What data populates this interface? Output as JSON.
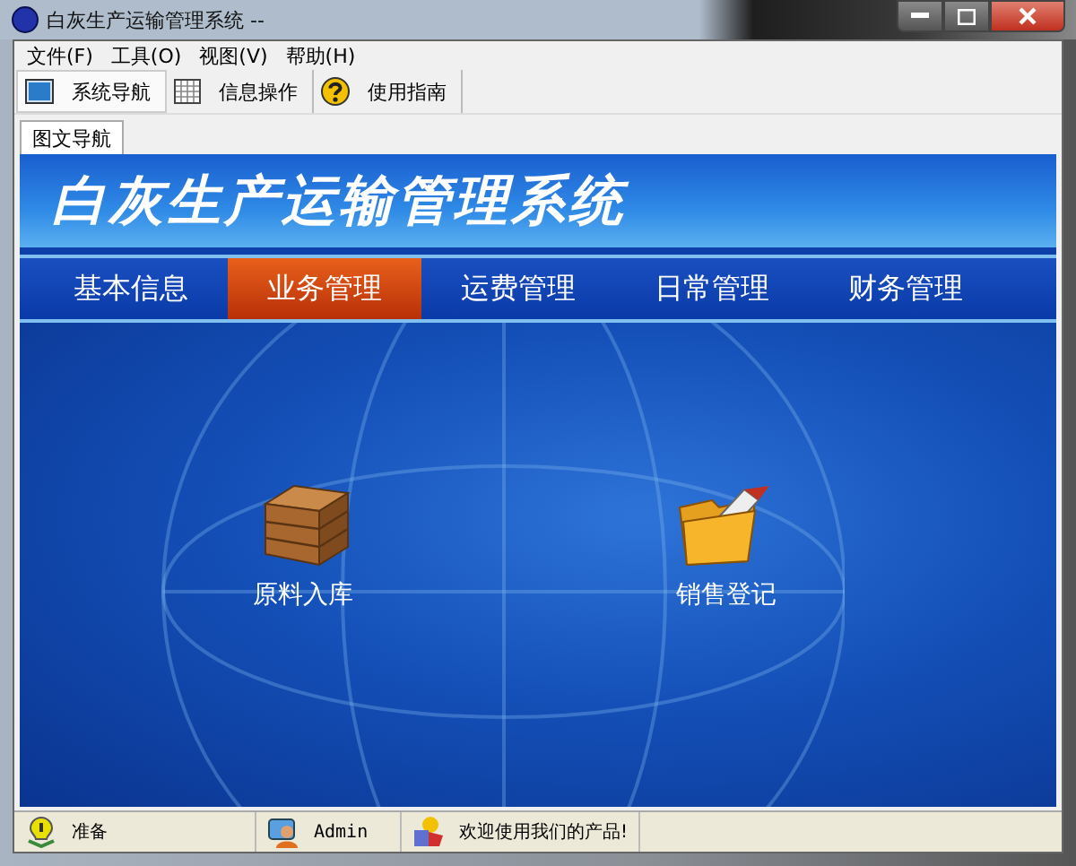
{
  "window": {
    "title": "白灰生产运输管理系统 --"
  },
  "menu": [
    {
      "label": "文件(F)"
    },
    {
      "label": "工具(O)"
    },
    {
      "label": "视图(V)"
    },
    {
      "label": "帮助(H)"
    }
  ],
  "toolbar": [
    {
      "label": "系统导航",
      "kind": "nav",
      "selected": true
    },
    {
      "label": "信息操作",
      "kind": "grid",
      "selected": false
    },
    {
      "label": "使用指南",
      "kind": "help",
      "selected": false
    }
  ],
  "doc_tabs": [
    {
      "label": "图文导航",
      "selected": true
    }
  ],
  "banner": {
    "title": "白灰生产运输管理系统"
  },
  "nav": [
    {
      "label": "基本信息",
      "selected": false
    },
    {
      "label": "业务管理",
      "selected": true
    },
    {
      "label": "运费管理",
      "selected": false
    },
    {
      "label": "日常管理",
      "selected": false
    },
    {
      "label": "财务管理",
      "selected": false
    }
  ],
  "shortcuts": [
    {
      "label": "原料入库",
      "kind": "crate"
    },
    {
      "label": "销售登记",
      "kind": "folder"
    }
  ],
  "status_bar": [
    {
      "text": "准备",
      "kind": "ready"
    },
    {
      "text": "Admin",
      "kind": "user"
    },
    {
      "text": "欢迎使用我们的产品!",
      "kind": "welcome"
    }
  ]
}
